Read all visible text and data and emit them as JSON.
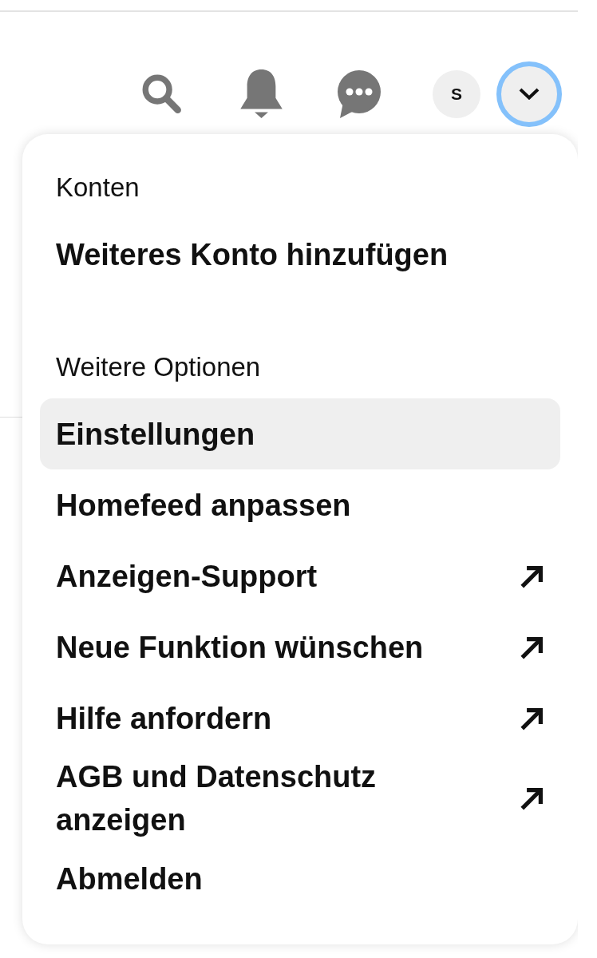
{
  "header": {
    "account": {
      "initial": "S"
    },
    "menu_button": {
      "expanded": true
    }
  },
  "menu": {
    "sections": [
      {
        "heading": "Konten",
        "items": [
          {
            "label": "Weiteres Konto hinzufügen",
            "selected": false,
            "external": false
          }
        ]
      },
      {
        "heading": "Weitere Optionen",
        "items": [
          {
            "label": "Einstellungen",
            "selected": true,
            "external": false
          },
          {
            "label": "Homefeed anpassen",
            "selected": false,
            "external": false
          },
          {
            "label": "Anzeigen-Support",
            "selected": false,
            "external": true
          },
          {
            "label": "Neue Funktion wünschen",
            "selected": false,
            "external": true
          },
          {
            "label": "Hilfe anfordern",
            "selected": false,
            "external": true
          },
          {
            "label": "AGB und Datenschutz anzeigen",
            "selected": false,
            "external": true
          },
          {
            "label": "Abmelden",
            "selected": false,
            "external": false
          }
        ]
      }
    ]
  }
}
